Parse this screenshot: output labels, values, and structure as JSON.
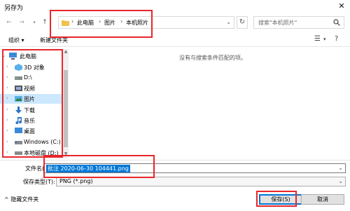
{
  "window": {
    "title": "另存为"
  },
  "nav": {
    "breadcrumbs": [
      "此电脑",
      "图片",
      "本机照片"
    ],
    "search_placeholder": "搜索\"本机照片\""
  },
  "toolbar": {
    "organize": "组织 ▾",
    "new_folder": "新建文件夹"
  },
  "sidebar": {
    "items": [
      {
        "label": "此电脑",
        "icon": "computer-icon"
      },
      {
        "label": "3D 对象",
        "icon": "3d-objects-icon"
      },
      {
        "label": "D:\\",
        "icon": "drive-icon"
      },
      {
        "label": "视频",
        "icon": "video-icon"
      },
      {
        "label": "图片",
        "icon": "pictures-icon"
      },
      {
        "label": "下载",
        "icon": "download-icon"
      },
      {
        "label": "音乐",
        "icon": "music-icon"
      },
      {
        "label": "桌面",
        "icon": "desktop-icon"
      },
      {
        "label": "Windows (C:)",
        "icon": "windows-drive-icon"
      },
      {
        "label": "本地磁盘 (D:)",
        "icon": "drive-icon"
      }
    ]
  },
  "content": {
    "empty_message": "没有与搜索条件匹配的项。"
  },
  "form": {
    "filename_label": "文件名(N):",
    "filename_value": "批注 2020-06-30 104441.png",
    "type_label": "保存类型(T):",
    "type_value": "PNG (*.png)"
  },
  "footer": {
    "hide_folders": "隐藏文件夹",
    "save_label": "保存(S)",
    "cancel_label": "取消"
  },
  "colors": {
    "accent": "#0078d7",
    "highlight": "#e8262b",
    "selected_bg": "#cce8ff"
  }
}
